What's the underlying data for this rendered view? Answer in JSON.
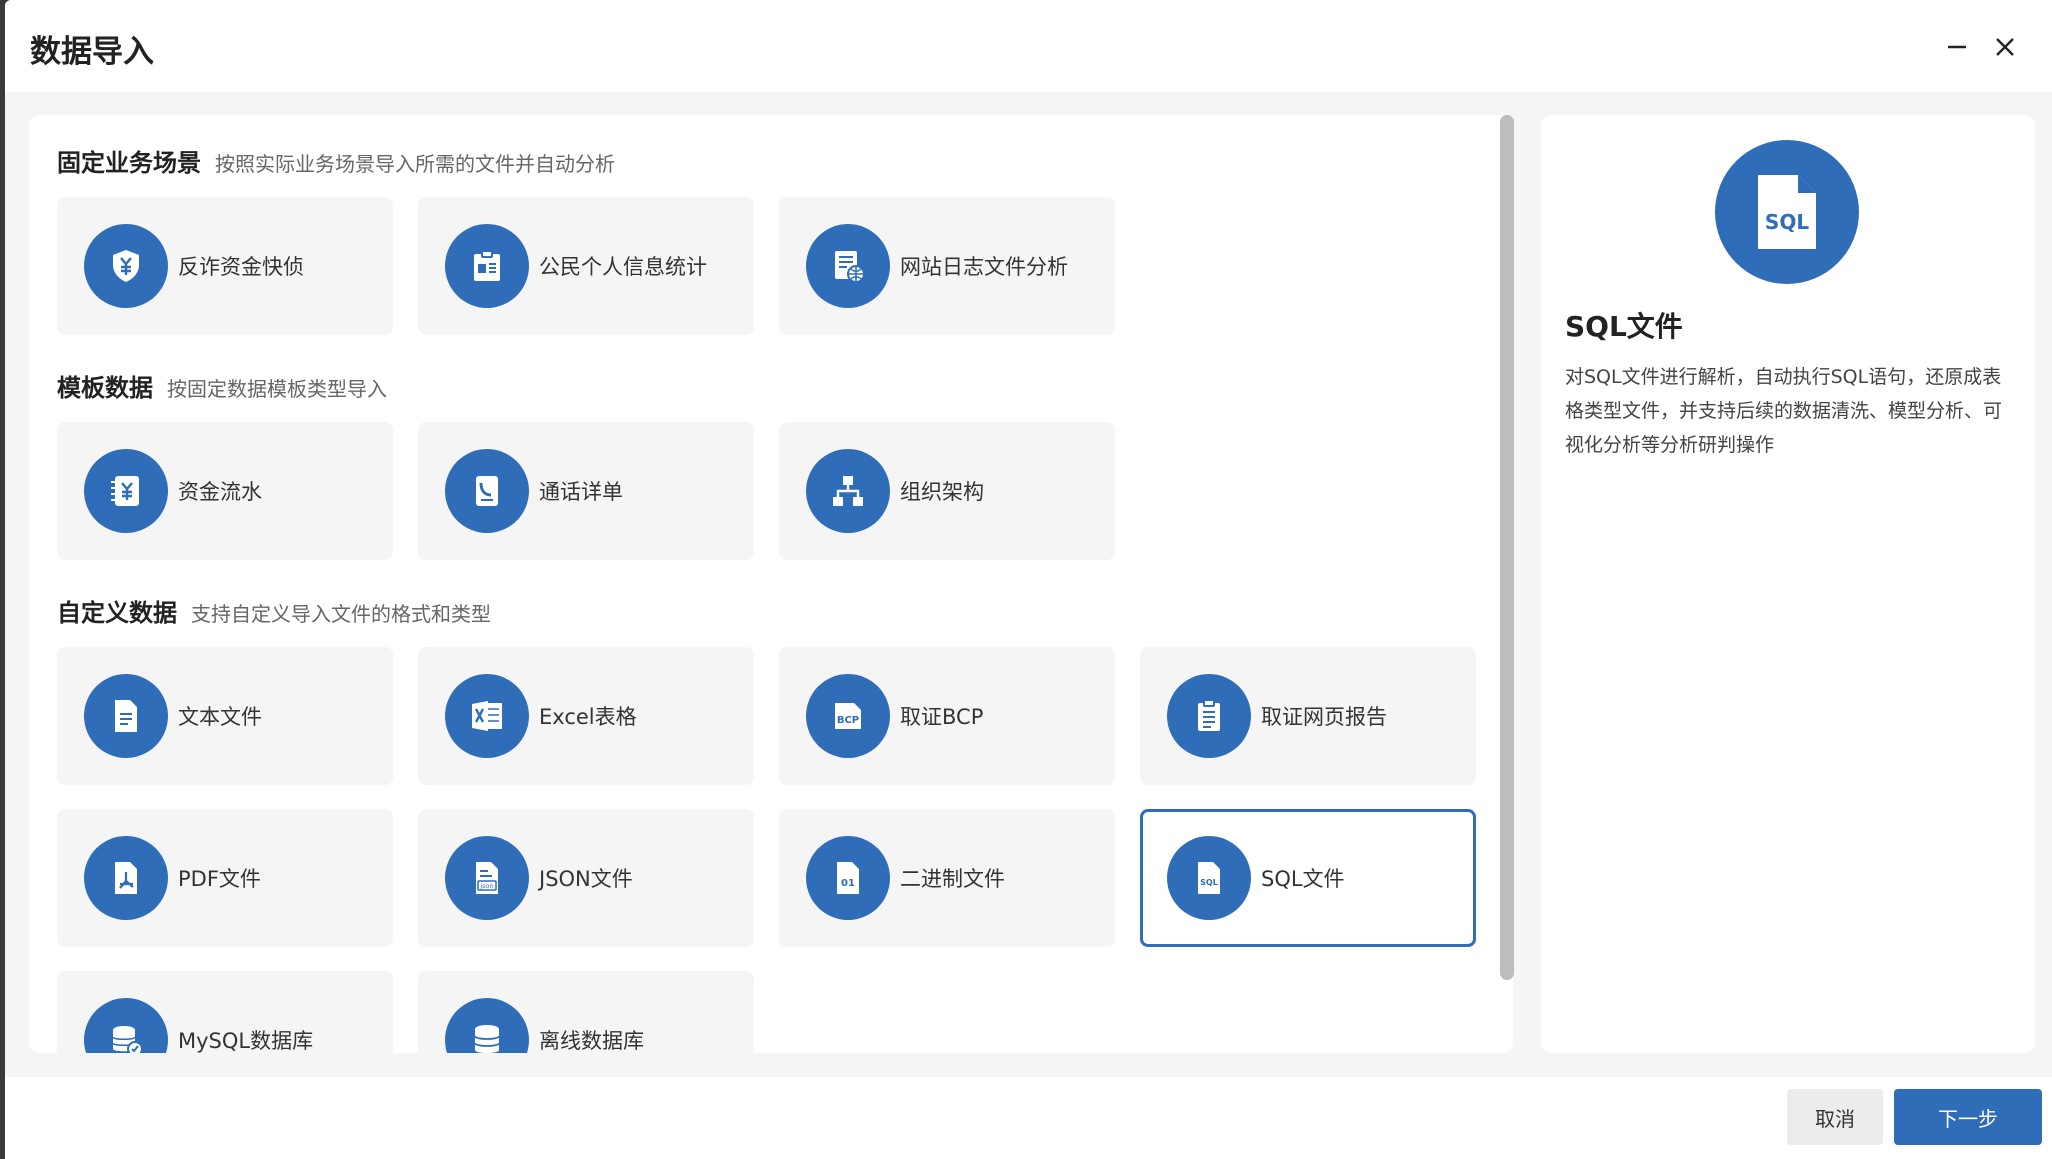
{
  "dialog": {
    "title": "数据导入",
    "minimize_icon": "minimize-icon",
    "close_icon": "close-icon"
  },
  "sections": [
    {
      "title": "固定业务场景",
      "desc": "按照实际业务场景导入所需的文件并自动分析",
      "items": [
        {
          "label": "反诈资金快侦",
          "icon": "shield-yen-icon"
        },
        {
          "label": "公民个人信息统计",
          "icon": "id-clipboard-icon"
        },
        {
          "label": "网站日志文件分析",
          "icon": "web-log-icon"
        }
      ]
    },
    {
      "title": "模板数据",
      "desc": "按固定数据模板类型导入",
      "items": [
        {
          "label": "资金流水",
          "icon": "money-flow-icon"
        },
        {
          "label": "通话详单",
          "icon": "phone-record-icon"
        },
        {
          "label": "组织架构",
          "icon": "org-chart-icon"
        }
      ]
    },
    {
      "title": "自定义数据",
      "desc": "支持自定义导入文件的格式和类型",
      "items": [
        {
          "label": "文本文件",
          "icon": "text-file-icon"
        },
        {
          "label": "Excel表格",
          "icon": "excel-icon"
        },
        {
          "label": "取证BCP",
          "icon": "bcp-icon",
          "badge": "BCP"
        },
        {
          "label": "取证网页报告",
          "icon": "web-report-icon"
        },
        {
          "label": "PDF文件",
          "icon": "pdf-icon"
        },
        {
          "label": "JSON文件",
          "icon": "json-file-icon",
          "badge": "json"
        },
        {
          "label": "二进制文件",
          "icon": "binary-file-icon",
          "badge": "01"
        },
        {
          "label": "SQL文件",
          "icon": "sql-file-icon",
          "badge": "SQL",
          "selected": true
        },
        {
          "label": "MySQL数据库",
          "icon": "mysql-db-icon"
        },
        {
          "label": "离线数据库",
          "icon": "offline-db-icon"
        }
      ]
    }
  ],
  "detail": {
    "icon": "sql-file-icon",
    "icon_text": "SQL",
    "title": "SQL文件",
    "description": "对SQL文件进行解析，自动执行SQL语句，还原成表格类型文件，并支持后续的数据清洗、模型分析、可视化分析等分析研判操作"
  },
  "footer": {
    "cancel_label": "取消",
    "next_label": "下一步"
  },
  "colors": {
    "accent": "#2f6db8",
    "card_bg": "#f5f5f5",
    "panel_bg": "#ffffff"
  }
}
